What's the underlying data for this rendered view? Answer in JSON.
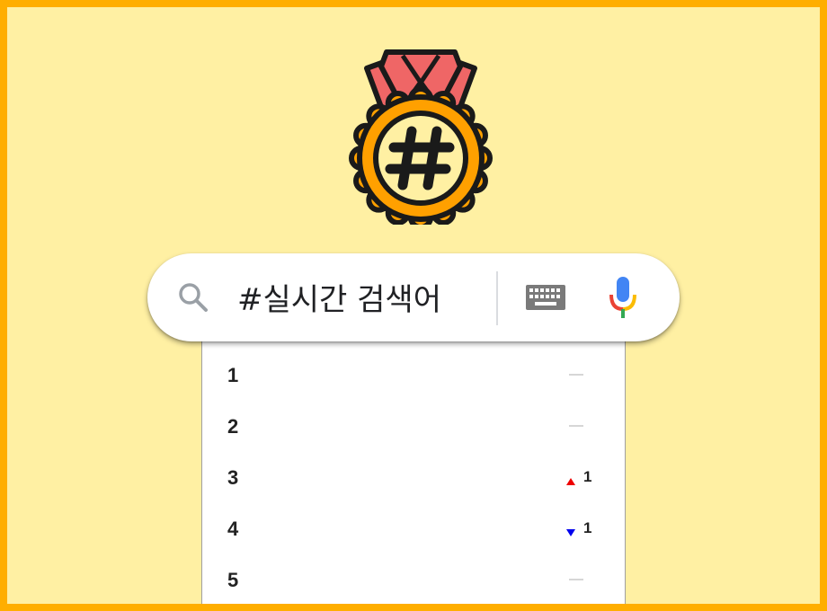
{
  "search": {
    "value": "#실시간 검색어",
    "placeholder": ""
  },
  "icons": {
    "medal": "hashtag-medal-icon",
    "search": "search-icon",
    "keyboard": "keyboard-icon",
    "microphone": "microphone-icon"
  },
  "colors": {
    "background": "#FFF0A3",
    "border": "#FFAE00",
    "ribbon": "#EF6666",
    "medal_orange": "#FFA000",
    "medal_face": "#FFF0A3",
    "rank_up": "#EE0000",
    "rank_down": "#0000EE",
    "rank_same": "#D6D6D6"
  },
  "rankings": [
    {
      "rank": "1",
      "trend": "same",
      "change": ""
    },
    {
      "rank": "2",
      "trend": "same",
      "change": ""
    },
    {
      "rank": "3",
      "trend": "up",
      "change": "1"
    },
    {
      "rank": "4",
      "trend": "down",
      "change": "1"
    },
    {
      "rank": "5",
      "trend": "same",
      "change": ""
    }
  ]
}
